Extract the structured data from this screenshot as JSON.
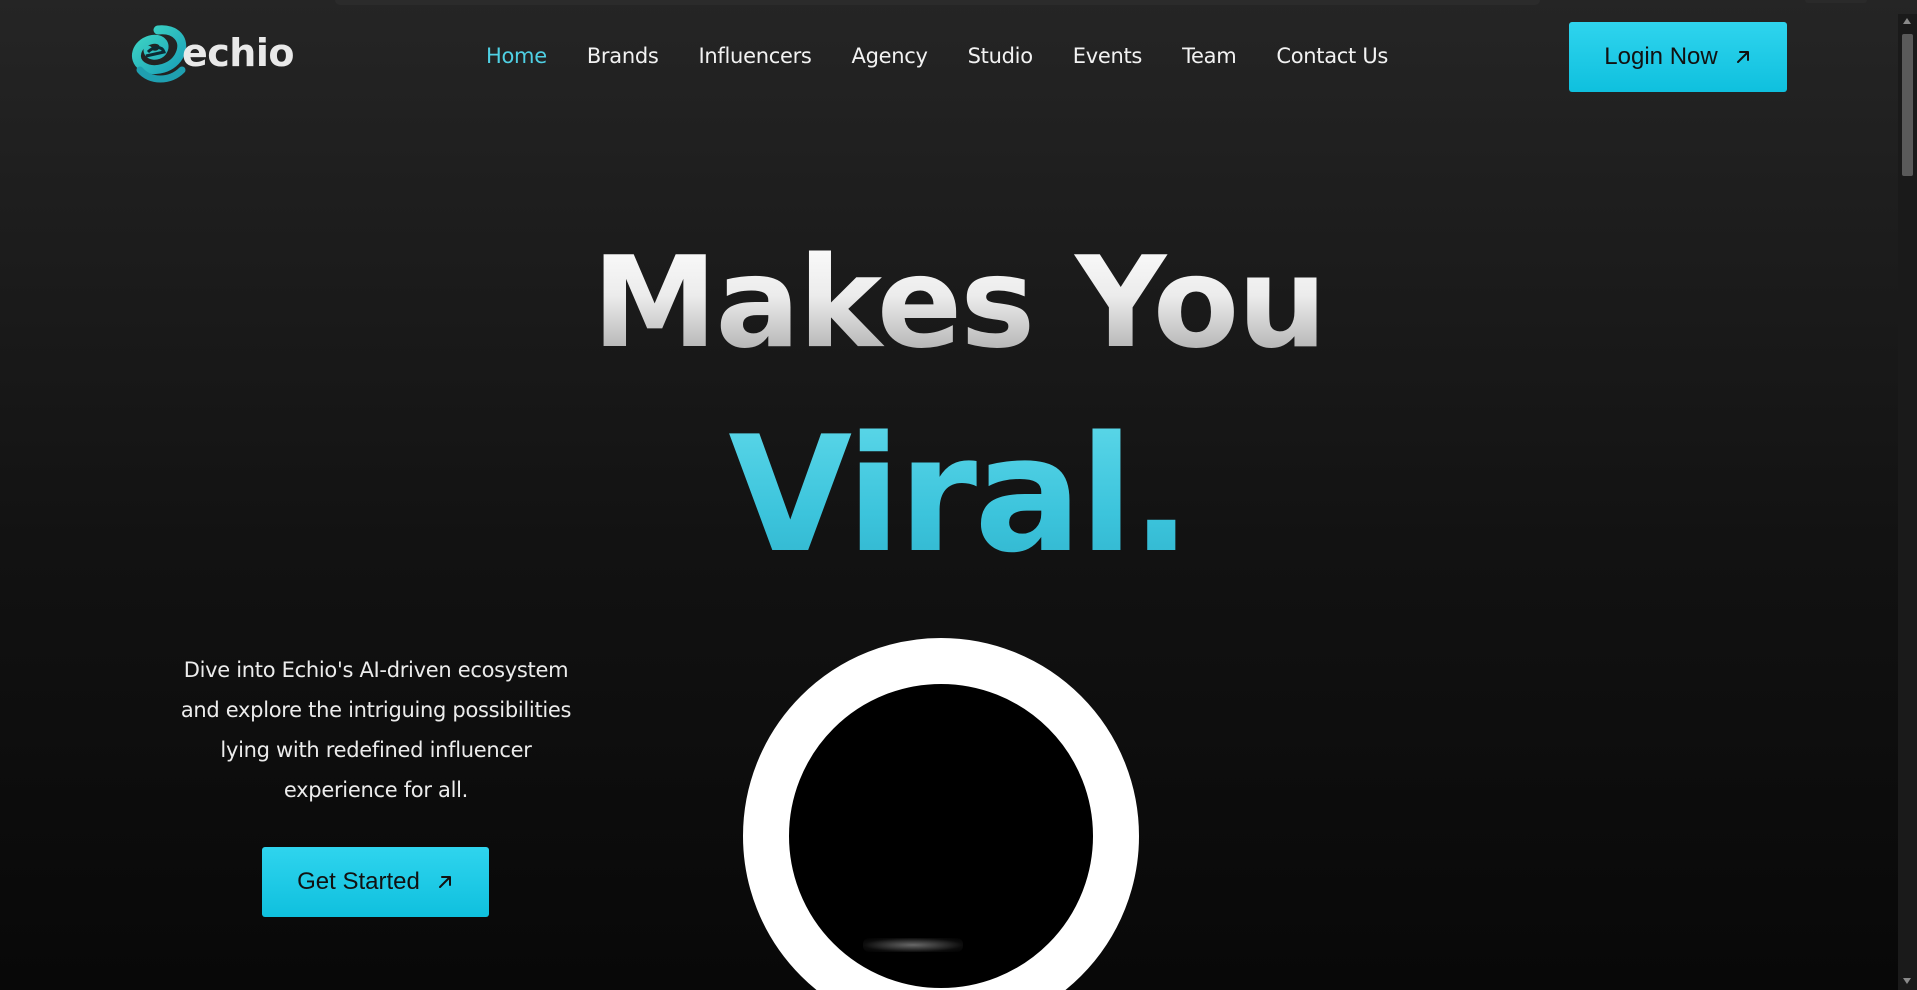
{
  "brand": {
    "logo_text": "echio",
    "logo_icon": "echio-swirl-e-logo",
    "accent_color": "#22c9e4"
  },
  "nav": {
    "items": [
      {
        "label": "Home",
        "active": true
      },
      {
        "label": "Brands",
        "active": false
      },
      {
        "label": "Influencers",
        "active": false
      },
      {
        "label": "Agency",
        "active": false
      },
      {
        "label": "Studio",
        "active": false
      },
      {
        "label": "Events",
        "active": false
      },
      {
        "label": "Team",
        "active": false
      },
      {
        "label": "Contact Us",
        "active": false
      }
    ],
    "active_color": "#4fd0e4"
  },
  "header": {
    "login_label": "Login Now",
    "login_icon": "arrow-up-right-icon"
  },
  "hero": {
    "headline_line1": "Makes You",
    "headline_line2": "Viral.",
    "description": "Dive into Echio's AI-driven ecosystem and explore the intriguing possibilities lying with redefined influencer experience for all.",
    "cta_label": "Get Started",
    "cta_icon": "arrow-up-right-icon"
  }
}
